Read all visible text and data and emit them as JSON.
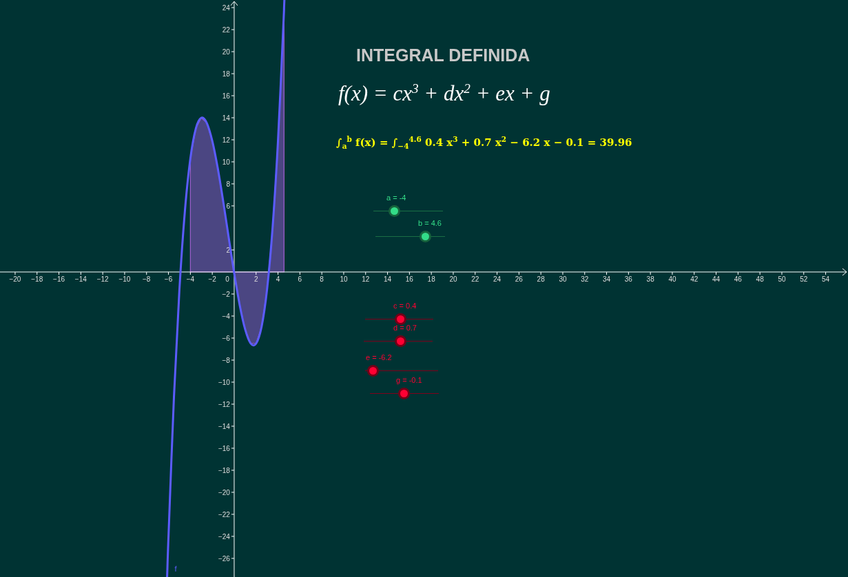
{
  "title": "INTEGRAL DEFINIDA",
  "formula": "f(x) = cx$^{3}$ + dx$^{2}$ + ex + g",
  "integral": "∫$_{a}$$^{b}$ f(x) = ∫$_{−4}$$^{4.6}$ 0.4 x$^{3}$ + 0.7 x$^{2}$ − 6.2 x − 0.1 = 39.96",
  "sliders": [
    {
      "label": "a = -4",
      "level": 0.3,
      "color": "#33dd88"
    },
    {
      "label": "b = 4.6",
      "level": 0.72,
      "color": "#33dd88"
    },
    {
      "label": "c = 0.4",
      "level": 0.52,
      "color": "#ff0033"
    },
    {
      "label": "d = 0.7",
      "level": 0.53,
      "color": "#ff0033"
    },
    {
      "label": "e = -6.2",
      "level": 0.11,
      "color": "#ff0033"
    },
    {
      "label": "g = -0.1",
      "level": 0.49,
      "color": "#ff0033"
    }
  ],
  "graph": {
    "origin_label": "0",
    "chart_data": {
      "type": "line",
      "x": [
        -6.1,
        -6,
        -5.5,
        -5,
        -4.5,
        -4,
        -3.5,
        -3,
        -2.5,
        -2,
        -1.5,
        -1,
        -0.5,
        0,
        0.5,
        1,
        1.5,
        2,
        2.5,
        3,
        3.5,
        4,
        4.5,
        4.55
      ],
      "series": [
        {
          "name": "f",
          "color": "#5c5cff",
          "values": [
            -27.02,
            -24.1,
            -11.38,
            -1.6,
            5.53,
            10.3,
            13.03,
            14.0,
            13.53,
            11.9,
            9.43,
            6.4,
            3.13,
            -0.1,
            -2.98,
            -5.2,
            -6.48,
            -6.5,
            -4.98,
            -1.6,
            3.93,
            11.9,
            22.63,
            23.86
          ]
        },
        {
          "type": "area",
          "color": "#4b4682",
          "values": [
            null,
            null,
            null,
            null,
            null,
            10.3,
            13.03,
            14.0,
            13.53,
            11.9,
            9.43,
            6.4,
            3.13,
            -0.1,
            -2.98,
            -5.2,
            -6.48,
            -6.5,
            -4.98,
            -1.6,
            3.93,
            11.9,
            22.63,
            23.86
          ]
        }
      ],
      "xlim": [
        -21.38,
        56.04
      ],
      "ylim": [
        -27.69,
        24.69
      ],
      "xticks": [
        -20,
        -18,
        -16,
        -14,
        -12,
        -10,
        -8,
        -6,
        -4,
        -2,
        2,
        4,
        6,
        8,
        10,
        12,
        14,
        16,
        18,
        20,
        22,
        24,
        26,
        28,
        30,
        32,
        34,
        36,
        38,
        40,
        42,
        44,
        46,
        48,
        50,
        52,
        54
      ],
      "yticks": [
        -26,
        -24,
        -22,
        -20,
        -18,
        -16,
        -14,
        -12,
        -10,
        -8,
        -6,
        -4,
        -2,
        2,
        6,
        8,
        10,
        12,
        14,
        16,
        18,
        20,
        22,
        24
      ]
    }
  }
}
